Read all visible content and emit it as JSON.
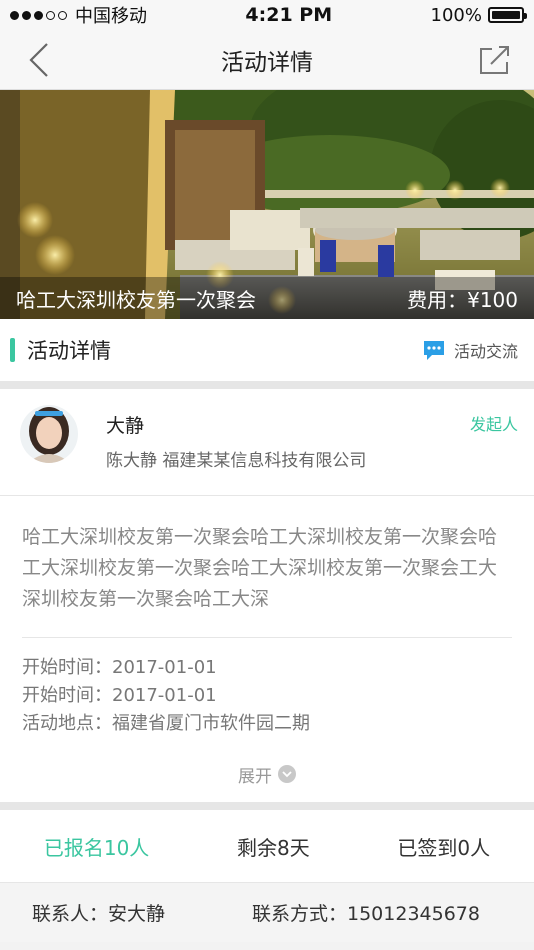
{
  "status_bar": {
    "carrier": "中国移动",
    "time": "4:21 PM",
    "battery": "100%"
  },
  "nav": {
    "title": "活动详情"
  },
  "banner": {
    "event_name": "哈工大深圳校友第一次聚会",
    "fee": "费用：¥100"
  },
  "section": {
    "title": "活动详情",
    "chat_label": "活动交流"
  },
  "organizer": {
    "name": "大静",
    "detail": "陈大静 福建某某信息科技有限公司",
    "role": "发起人"
  },
  "description": "哈工大深圳校友第一次聚会哈工大深圳校友第一次聚会哈工大深圳校友第一次聚会哈工大深圳校友第一次聚会工大深圳校友第一次聚会哈工大深",
  "meta": {
    "start_time_1": "开始时间：2017-01-01",
    "start_time_2": "开始时间：2017-01-01",
    "location": "活动地点：福建省厦门市软件园二期"
  },
  "expand_label": "展开",
  "stats": {
    "registered": "已报名10人",
    "remaining": "剩余8天",
    "checked_in": "已签到0人"
  },
  "contact": {
    "person": "联系人：安大静",
    "phone": "联系方式：15012345678"
  },
  "colors": {
    "accent": "#3bc6a0",
    "chat_icon": "#2b9fe6"
  }
}
